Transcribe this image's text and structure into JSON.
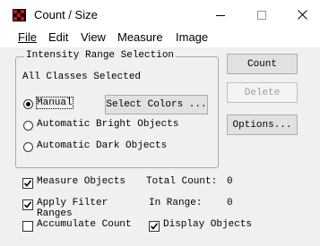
{
  "window": {
    "title": "Count / Size",
    "icon": "red-black-pattern-icon",
    "controls": [
      "minimize-icon",
      "maximize-icon",
      "close-icon"
    ]
  },
  "menu": [
    {
      "label": "File",
      "mnemonic": "F"
    },
    {
      "label": "Edit",
      "mnemonic": "E"
    },
    {
      "label": "View",
      "mnemonic": "V"
    },
    {
      "label": "Measure",
      "mnemonic": "M"
    },
    {
      "label": "Image",
      "mnemonic": "I"
    }
  ],
  "range_group": {
    "title": "Intensity Range Selection",
    "status_text": "All Classes Selected",
    "options": [
      {
        "label": "Manual",
        "checked": true
      },
      {
        "label": "Automatic Bright Objects",
        "checked": false
      },
      {
        "label": "Automatic Dark Objects",
        "checked": false
      }
    ],
    "select_colors_label": "Select Colors ..."
  },
  "side_buttons": {
    "count_label": "Count",
    "delete_label": "Delete",
    "delete_enabled": false,
    "options_label": "Options..."
  },
  "checks": {
    "measure_objects": {
      "label": "Measure Objects",
      "checked": true
    },
    "apply_filter_ranges": {
      "label": "Apply Filter Ranges",
      "checked": true
    },
    "accumulate_count": {
      "label": "Accumulate Count",
      "checked": false
    },
    "display_objects": {
      "label": "Display Objects",
      "checked": true
    }
  },
  "stats": {
    "total_count_label": "Total Count:",
    "total_count_value": "0",
    "in_range_label": "In Range:",
    "in_range_value": "0"
  },
  "colors": {
    "title_bar_bg": "#ffffff",
    "dialog_bg": "#f0f0f0",
    "icon_red": "#d01010",
    "disabled_text": "#a0a0a0"
  }
}
